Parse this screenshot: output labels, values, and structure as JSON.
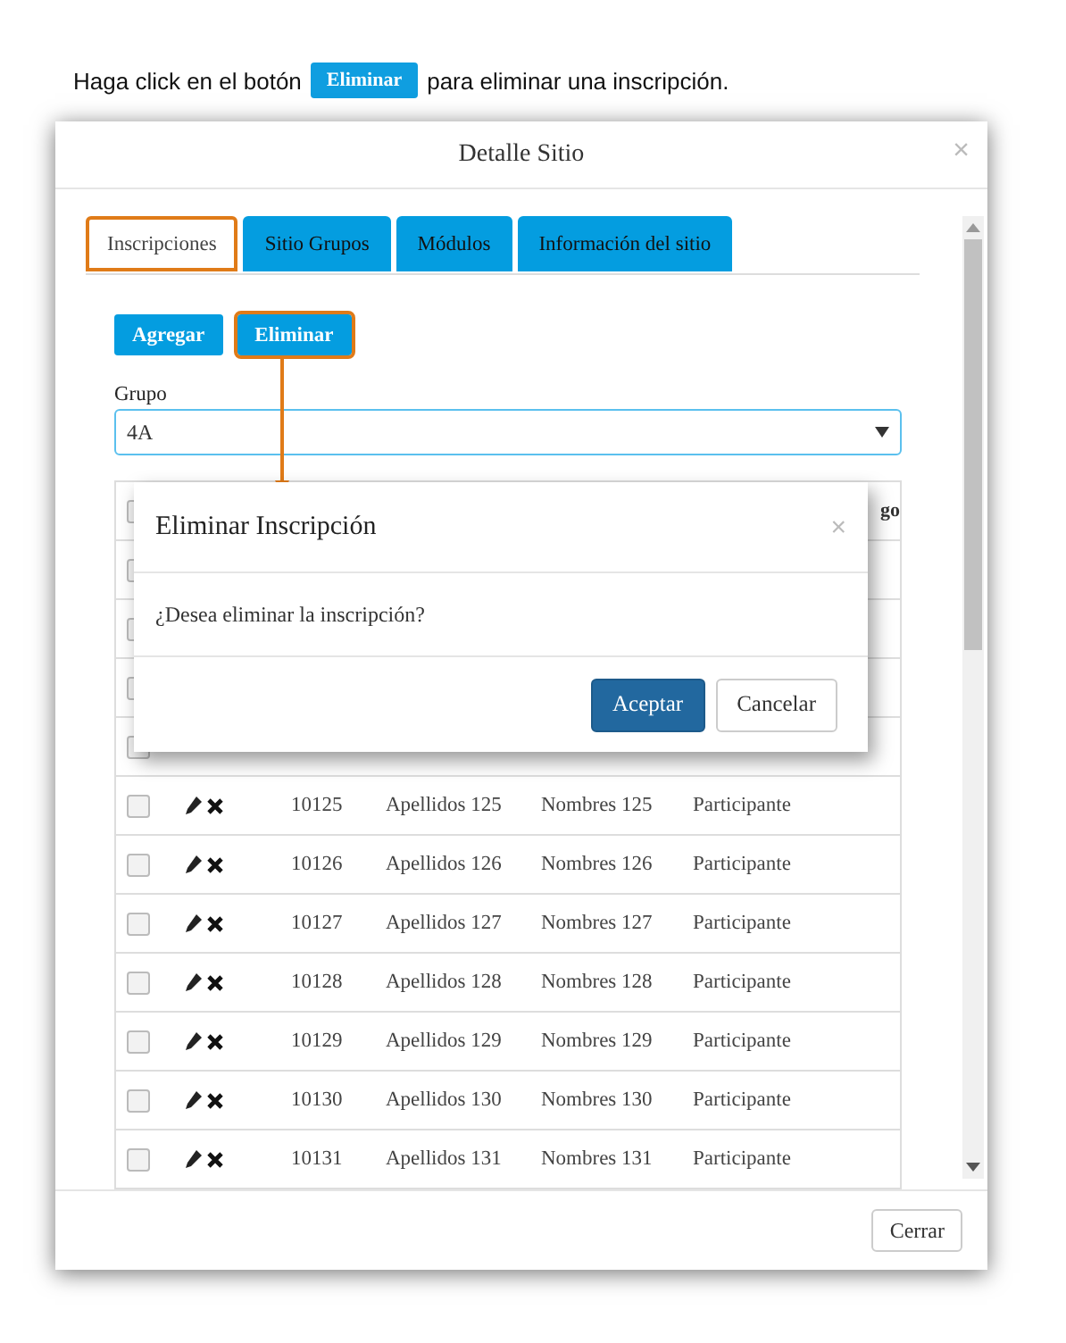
{
  "instruction": {
    "before": "Haga click en el botón",
    "button": "Eliminar",
    "after": "para eliminar una inscripción."
  },
  "window": {
    "title": "Detalle Sitio",
    "close": "×"
  },
  "tabs": [
    {
      "label": "Inscripciones",
      "selected": true,
      "highlighted": true
    },
    {
      "label": "Sitio Grupos",
      "selected": false,
      "highlighted": false
    },
    {
      "label": "Módulos",
      "selected": false,
      "highlighted": false
    },
    {
      "label": "Información del sitio",
      "selected": false,
      "highlighted": false
    }
  ],
  "actions": [
    {
      "label": "Agregar",
      "highlighted": false
    },
    {
      "label": "Eliminar",
      "highlighted": true
    }
  ],
  "group_field": {
    "label": "Grupo",
    "value": "4A"
  },
  "table": {
    "header_fragment": "go",
    "header_checked": false,
    "covered_rows": [
      {
        "checked": false
      },
      {
        "checked": false
      },
      {
        "checked": false
      },
      {
        "checked": false
      }
    ],
    "rows": [
      {
        "checked": false,
        "id": "10125",
        "surnames": "Apellidos 125",
        "names": "Nombres 125",
        "role": "Participante"
      },
      {
        "checked": false,
        "id": "10126",
        "surnames": "Apellidos 126",
        "names": "Nombres 126",
        "role": "Participante"
      },
      {
        "checked": false,
        "id": "10127",
        "surnames": "Apellidos 127",
        "names": "Nombres 127",
        "role": "Participante"
      },
      {
        "checked": false,
        "id": "10128",
        "surnames": "Apellidos 128",
        "names": "Nombres 128",
        "role": "Participante"
      },
      {
        "checked": false,
        "id": "10129",
        "surnames": "Apellidos 129",
        "names": "Nombres 129",
        "role": "Participante"
      },
      {
        "checked": false,
        "id": "10130",
        "surnames": "Apellidos 130",
        "names": "Nombres 130",
        "role": "Participante"
      },
      {
        "checked": false,
        "id": "10131",
        "surnames": "Apellidos 131",
        "names": "Nombres 131",
        "role": "Participante"
      }
    ]
  },
  "dialog": {
    "title": "Eliminar Inscripción",
    "close": "×",
    "message": "¿Desea eliminar la inscripción?",
    "confirm": "Aceptar",
    "cancel": "Cancelar"
  },
  "footer": {
    "close_button": "Cerrar"
  }
}
